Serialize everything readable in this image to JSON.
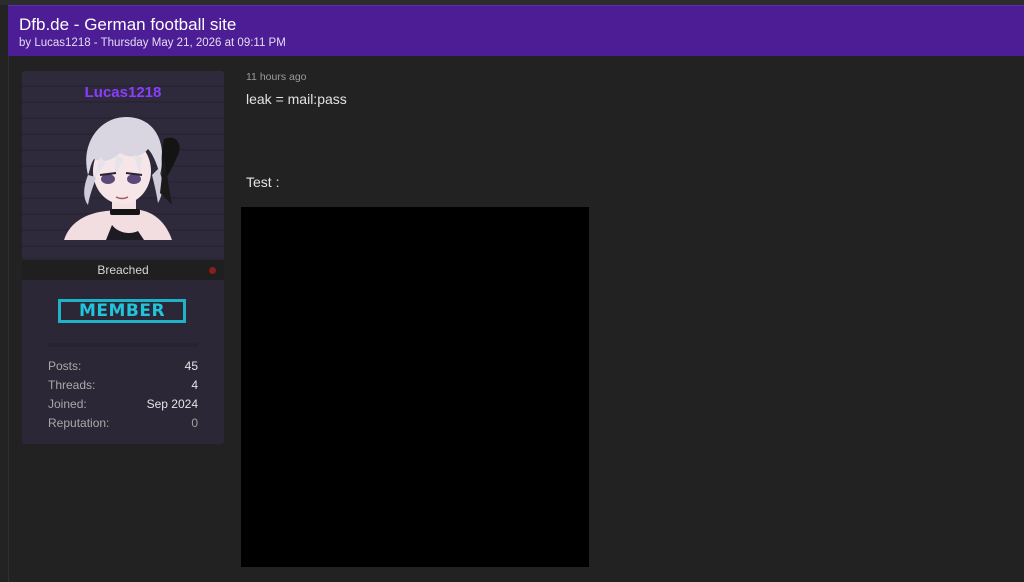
{
  "thread": {
    "title": "Dfb.de - German football site",
    "meta": "by Lucas1218 - Thursday May 21, 2026 at 09:11 PM"
  },
  "author": {
    "username": "Lucas1218",
    "status": "Breached",
    "rank": "MEMBER",
    "stats": [
      {
        "label": "Posts:",
        "value": "45"
      },
      {
        "label": "Threads:",
        "value": "4"
      },
      {
        "label": "Joined:",
        "value": "Sep 2024"
      },
      {
        "label": "Reputation:",
        "value": "0"
      }
    ]
  },
  "post": {
    "time": "11 hours ago",
    "line1": "leak = mail:pass",
    "line2": "Test :"
  },
  "colors": {
    "header_bg": "#4c1d95",
    "username": "#8b3dff",
    "rank": "#21c4da",
    "status_dot": "#8a1f1f"
  },
  "icons": {
    "avatar": "anime-avatar-image",
    "status_dot": "offline-status-dot",
    "post_image": "redacted-image-placeholder"
  }
}
